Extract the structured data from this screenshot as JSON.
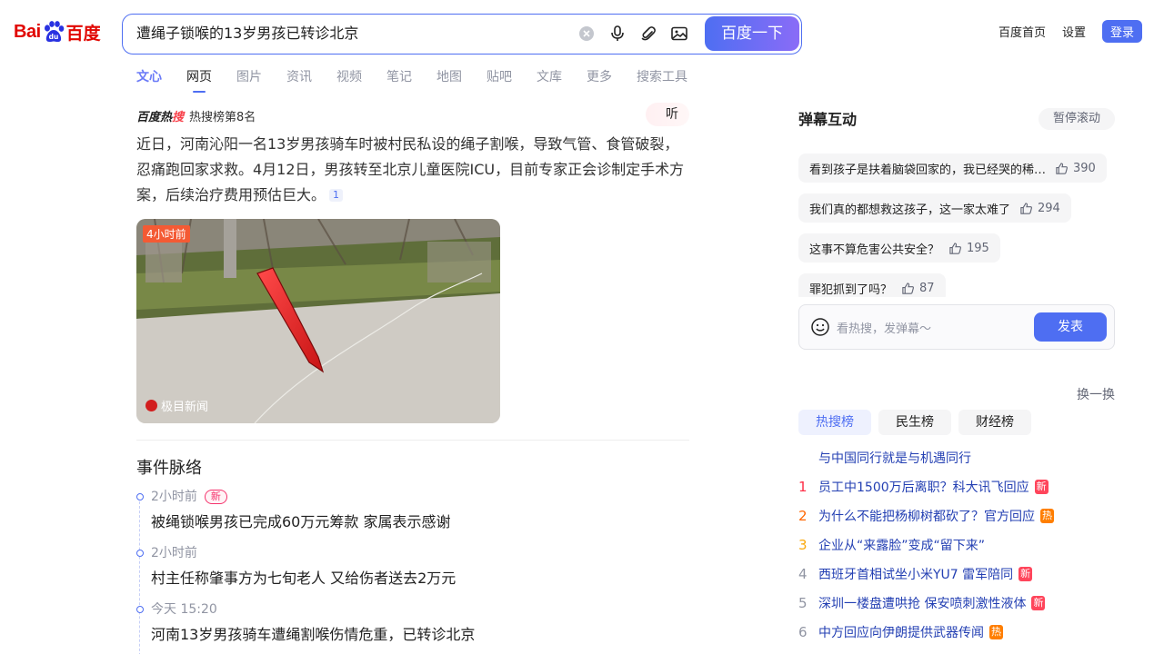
{
  "logo": {
    "text_bai": "Bai",
    "text_du": "百度"
  },
  "search": {
    "query": "遭绳子锁喉的13岁男孩已转诊北京",
    "button_label": "百度一下"
  },
  "top_links": {
    "home": "百度首页",
    "settings": "设置",
    "login": "登录"
  },
  "tabs": [
    "文心",
    "网页",
    "图片",
    "资讯",
    "视频",
    "笔记",
    "地图",
    "贴吧",
    "文库",
    "更多",
    "搜索工具"
  ],
  "hot": {
    "logo_text_a": "百度热",
    "logo_text_b": "搜",
    "rank_text": "热搜榜第8名",
    "listen_label": "听",
    "summary": "近日，河南沁阳一名13岁男孩骑车时被村民私设的绳子割喉，导致气管、食管破裂，忍痛跑回家求救。4月12日，男孩转至北京儿童医院ICU，目前专家正会诊制定手术方案，后续治疗费用预估巨大。",
    "ref": "1",
    "image_time": "4小时前",
    "image_source": "极目新闻"
  },
  "timeline": {
    "title": "事件脉络",
    "items": [
      {
        "time": "2小时前",
        "badge": "新",
        "text": "被绳锁喉男孩已完成60万元筹款 家属表示感谢"
      },
      {
        "time": "2小时前",
        "badge": "",
        "text": "村主任称肇事方为七旬老人 又给伤者送去2万元"
      },
      {
        "time": "今天 15:20",
        "badge": "",
        "text": "河南13岁男孩骑车遭绳割喉伤情危重，已转诊北京"
      }
    ]
  },
  "danmu": {
    "title": "弹幕互动",
    "pause_label": "暂停滚动",
    "items": [
      {
        "text": "看到孩子是扶着脑袋回家的，我已经哭的稀…",
        "likes": "390"
      },
      {
        "text": "我们真的都想救这孩子，这一家太难了",
        "likes": "294"
      },
      {
        "text": "这事不算危害公共安全？",
        "likes": "195"
      },
      {
        "text": "罪犯抓到了吗？",
        "likes": "87"
      }
    ],
    "input_placeholder": "看热搜，发弹幕～",
    "send_label": "发表"
  },
  "ranking": {
    "refresh_label": "换一换",
    "tabs": [
      "热搜榜",
      "民生榜",
      "财经榜"
    ],
    "items": [
      {
        "num": "",
        "title": "与中国同行就是与机遇同行",
        "tag": ""
      },
      {
        "num": "1",
        "title": "员工中1500万后离职？科大讯飞回应",
        "tag": "新"
      },
      {
        "num": "2",
        "title": "为什么不能把杨柳树都砍了？官方回应",
        "tag": "热"
      },
      {
        "num": "3",
        "title": "企业从“来露脸”变成“留下来”",
        "tag": ""
      },
      {
        "num": "4",
        "title": "西班牙首相试坐小米YU7 雷军陪同",
        "tag": "新"
      },
      {
        "num": "5",
        "title": "深圳一楼盘遭哄抢 保安喷刺激性液体",
        "tag": "新"
      },
      {
        "num": "6",
        "title": "中方回应向伊朗提供武器传闻",
        "tag": "热"
      }
    ]
  },
  "colors": {
    "brand_blue": "#4e6ef2",
    "baidu_red": "#e10601",
    "hot_red": "#fe2d46",
    "tag_orange": "#ff7e00"
  }
}
